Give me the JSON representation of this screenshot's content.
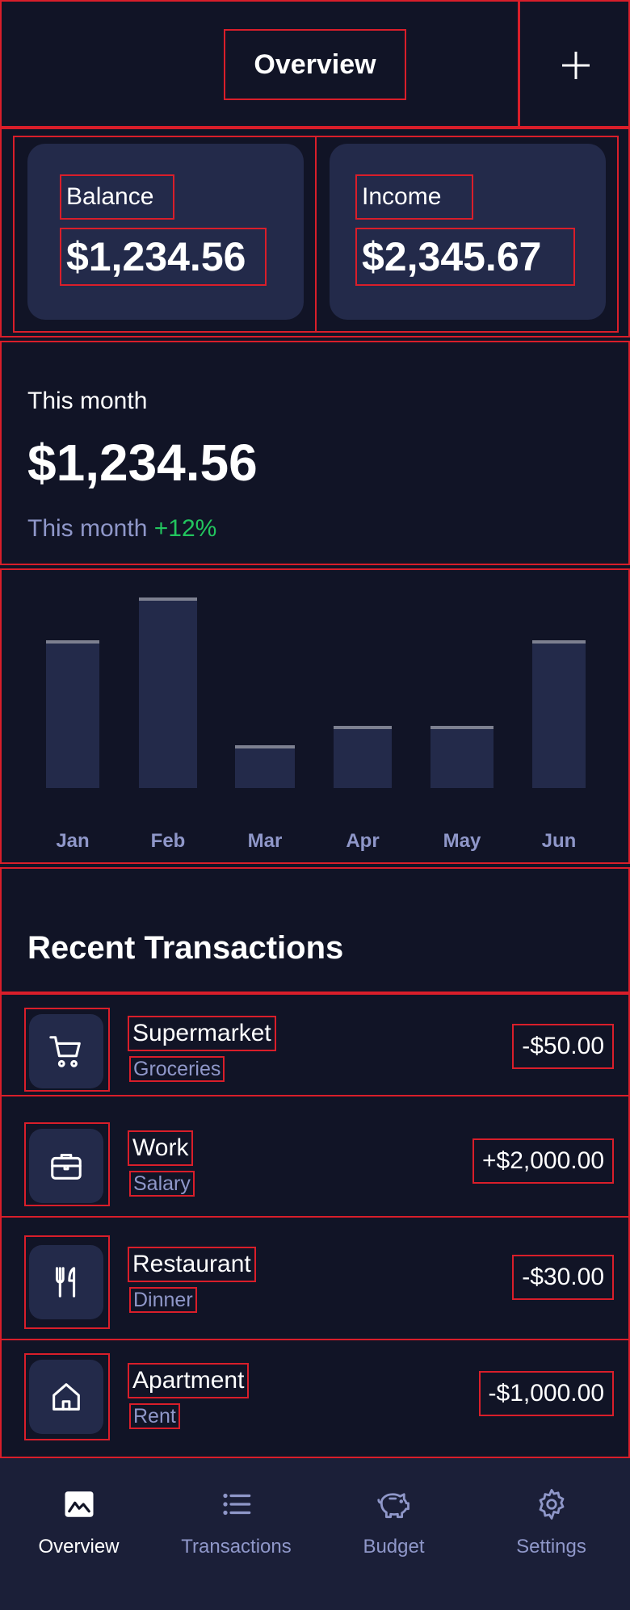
{
  "header": {
    "title": "Overview",
    "add_icon": "plus-icon"
  },
  "cards": [
    {
      "label": "Balance",
      "value": "$1,234.56"
    },
    {
      "label": "Income",
      "value": "$2,345.67"
    }
  ],
  "summary": {
    "label": "This month",
    "amount": "$1,234.56",
    "trend_label": "This month",
    "trend_pct": "+12%"
  },
  "chart_data": {
    "type": "bar",
    "categories": [
      "Jan",
      "Feb",
      "Mar",
      "Apr",
      "May",
      "Jun"
    ],
    "values": [
      190,
      245,
      55,
      80,
      80,
      190
    ],
    "ylim": [
      0,
      260
    ],
    "grid": false
  },
  "recent": {
    "title": "Recent Transactions"
  },
  "transactions": [
    {
      "icon": "cart-icon",
      "name": "Supermarket",
      "category": "Groceries",
      "amount": "-$50.00"
    },
    {
      "icon": "briefcase-icon",
      "name": "Work",
      "category": "Salary",
      "amount": "+$2,000.00"
    },
    {
      "icon": "utensils-icon",
      "name": "Restaurant",
      "category": "Dinner",
      "amount": "-$30.00"
    },
    {
      "icon": "home-icon",
      "name": "Apartment",
      "category": "Rent",
      "amount": "-$1,000.00"
    }
  ],
  "nav": [
    {
      "label": "Overview",
      "icon": "chart-icon",
      "active": true
    },
    {
      "label": "Transactions",
      "icon": "list-icon",
      "active": false
    },
    {
      "label": "Budget",
      "icon": "piggy-bank-icon",
      "active": false
    },
    {
      "label": "Settings",
      "icon": "gear-icon",
      "active": false
    }
  ],
  "colors": {
    "background": "#111426",
    "card": "#232a4a",
    "positive": "#22c55e",
    "muted": "#8f97c9",
    "outline": "#d91e2a"
  }
}
